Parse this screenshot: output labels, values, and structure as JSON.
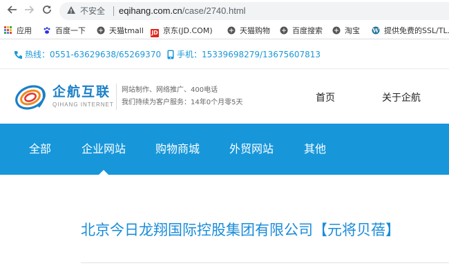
{
  "browser": {
    "security_label": "不安全",
    "url_host": "eqihang.com.cn",
    "url_path": "/case/2740.html"
  },
  "bookmarks": {
    "items": [
      {
        "label": "应用",
        "icon": "apps-grid-icon"
      },
      {
        "label": "百度一下",
        "icon": "baidu-paw-icon",
        "color": "#2932e1"
      },
      {
        "label": "天猫tmall",
        "icon": "globe-icon",
        "color": "#555555"
      },
      {
        "label": "京东(JD.COM)",
        "icon": "jd-icon",
        "color": "#e1251b"
      },
      {
        "label": "天猫购物",
        "icon": "globe-icon",
        "color": "#555555"
      },
      {
        "label": "百度搜索",
        "icon": "globe-icon",
        "color": "#555555"
      },
      {
        "label": "淘宝",
        "icon": "globe-icon",
        "color": "#555555"
      },
      {
        "label": "提供免费的SSL/TL...",
        "icon": "wordpress-icon",
        "color": "#21759b"
      }
    ]
  },
  "contact": {
    "hotline_label": "热线：",
    "hotline": "0551-63629638/65269370",
    "mobile_label": "手机：",
    "mobile": "15339698279/13675607813"
  },
  "header": {
    "logo_cn": "企航互联",
    "logo_en": "QIHANG INTERNET",
    "slogan_line1": "网站制作、网络推广、400电话",
    "slogan_line2": "我们持续为客户服务：14年0个月零5天",
    "nav": [
      "首页",
      "关于企航"
    ]
  },
  "categories": {
    "items": [
      "全部",
      "企业网站",
      "购物商城",
      "外贸网站",
      "其他"
    ],
    "active_index": 1
  },
  "article": {
    "title": "北京今日龙翔国际控股集团有限公司【元将贝蓓】"
  },
  "colors": {
    "brand_blue": "#1797da",
    "title_blue": "#1a8cd8"
  }
}
